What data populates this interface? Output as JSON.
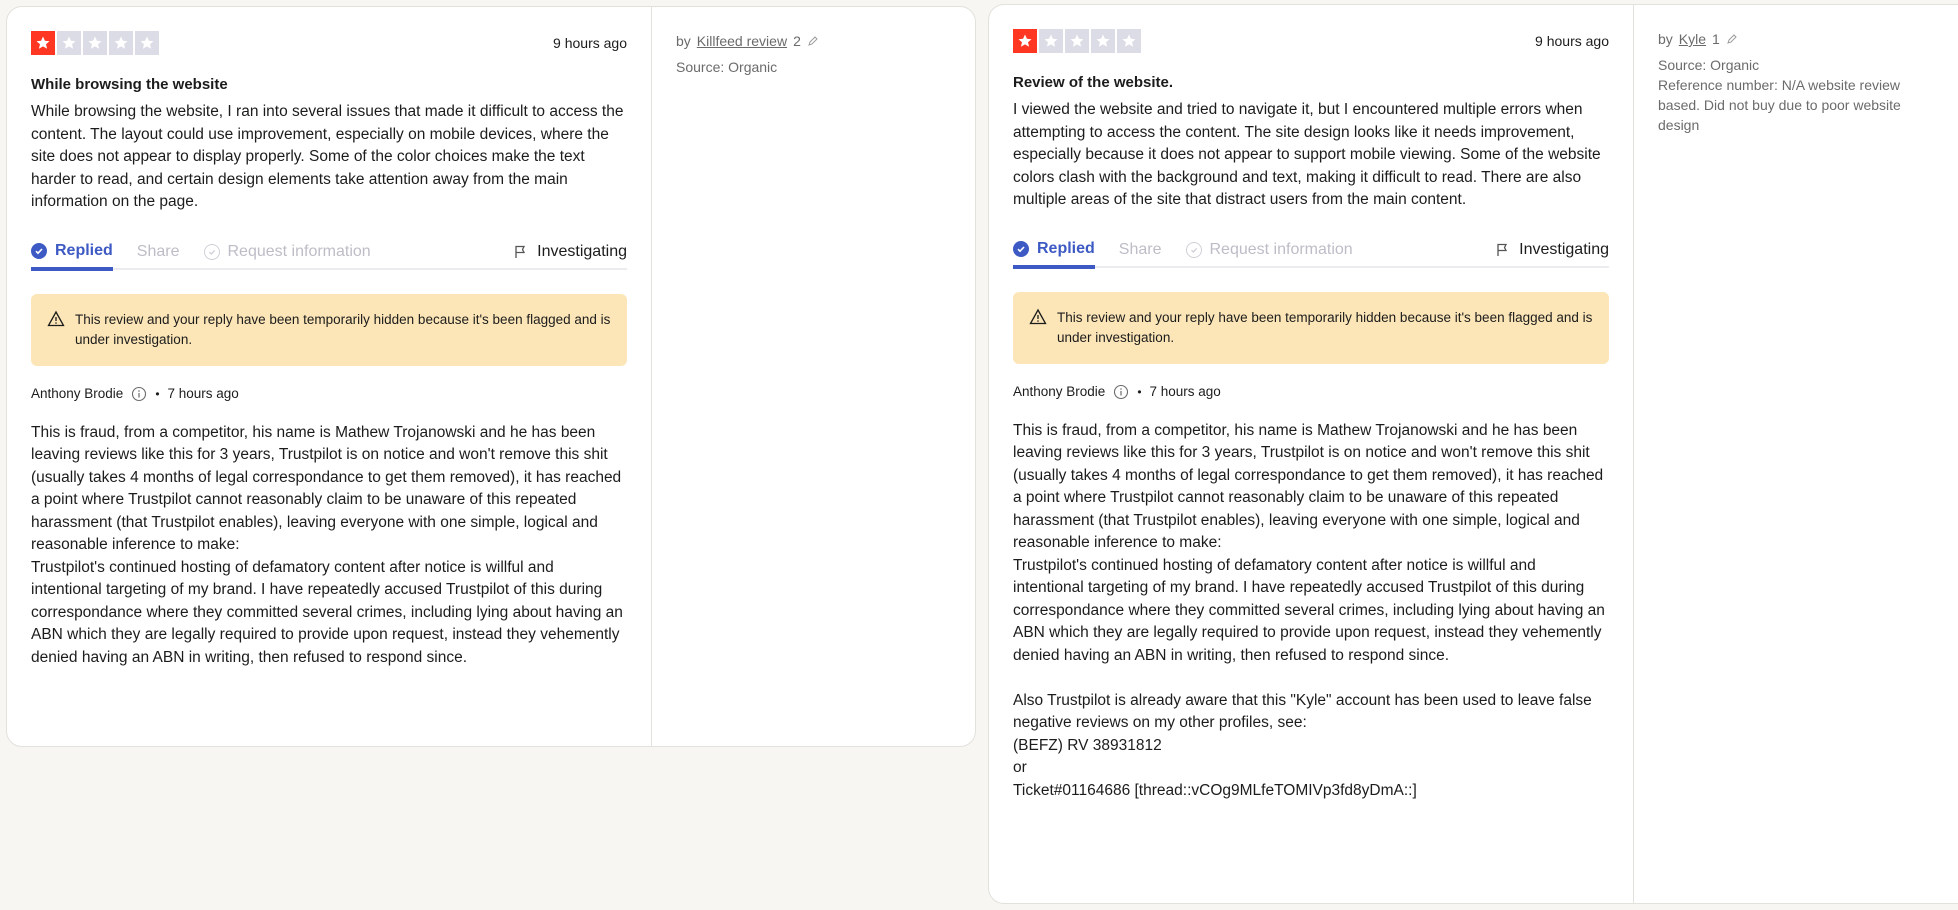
{
  "colors": {
    "star_active": "#ff3722",
    "star_inactive": "#dcdce6",
    "accent": "#3d5ac4",
    "notice_bg": "#fce6b7"
  },
  "reviews": [
    {
      "rating": 1,
      "time": "9 hours ago",
      "title": "While browsing the website",
      "body": "While browsing the website, I ran into several issues that made it difficult to access the content. The layout could use improvement, especially on mobile devices, where the site does not appear to display properly. Some of the color choices make the text harder to read, and certain design elements take attention away from the main information on the page.",
      "tabs": {
        "replied": "Replied",
        "share": "Share",
        "request": "Request information",
        "investigating": "Investigating"
      },
      "notice": "This review and your reply have been temporarily hidden because it's been flagged and is under investigation.",
      "reply": {
        "author": "Anthony Brodie",
        "time": "7 hours ago",
        "text": "This is fraud, from a competitor, his name is Mathew Trojanowski and he has been leaving reviews like this for 3 years, Trustpilot is on notice and won't remove this shit (usually takes 4 months of legal correspondance to get them removed), it has reached a point where Trustpilot cannot reasonably claim to be unaware of this repeated harassment (that Trustpilot enables), leaving everyone with one simple, logical and reasonable inference to make:\nTrustpilot's continued hosting of defamatory content after notice is willful and intentional targeting of my brand. I have repeatedly accused Trustpilot of this during correspondance where they committed several crimes, including lying about having an ABN which they are legally required to provide upon request, instead they vehemently denied having an ABN in writing, then refused to respond since."
      },
      "side": {
        "by": "by",
        "reviewer": "Killfeed review",
        "count": "2",
        "source": "Source: Organic",
        "reference": ""
      }
    },
    {
      "rating": 1,
      "time": "9 hours ago",
      "title": "Review of the website.",
      "body": "I viewed the website and tried to navigate it, but I encountered multiple errors when attempting to access the content. The site design looks like it needs improvement, especially because it does not appear to support mobile viewing. Some of the website colors clash with the background and text, making it difficult to read. There are also multiple areas of the site that distract users from the main content.",
      "tabs": {
        "replied": "Replied",
        "share": "Share",
        "request": "Request information",
        "investigating": "Investigating"
      },
      "notice": "This review and your reply have been temporarily hidden because it's been flagged and is under investigation.",
      "reply": {
        "author": "Anthony Brodie",
        "time": "7 hours ago",
        "text": "This is fraud, from a competitor, his name is Mathew Trojanowski and he has been leaving reviews like this for 3 years, Trustpilot is on notice and won't remove this shit (usually takes 4 months of legal correspondance to get them removed), it has reached a point where Trustpilot cannot reasonably claim to be unaware of this repeated harassment (that Trustpilot enables), leaving everyone with one simple, logical and reasonable inference to make:\nTrustpilot's continued hosting of defamatory content after notice is willful and intentional targeting of my brand. I have repeatedly accused Trustpilot of this during correspondance where they committed several crimes, including lying about having an ABN which they are legally required to provide upon request, instead they vehemently denied having an ABN in writing, then refused to respond since.\n\nAlso Trustpilot is already aware that this \"Kyle\" account has been used to leave false negative reviews on my other profiles, see:\n(BEFZ) RV 38931812\nor\nTicket#01164686 [thread::vCOg9MLfeTOMIVp3fd8yDmA::]"
      },
      "side": {
        "by": "by",
        "reviewer": "Kyle",
        "count": "1",
        "source": "Source: Organic",
        "reference": "Reference number: N/A website review based. Did not buy due to poor website design"
      }
    }
  ]
}
